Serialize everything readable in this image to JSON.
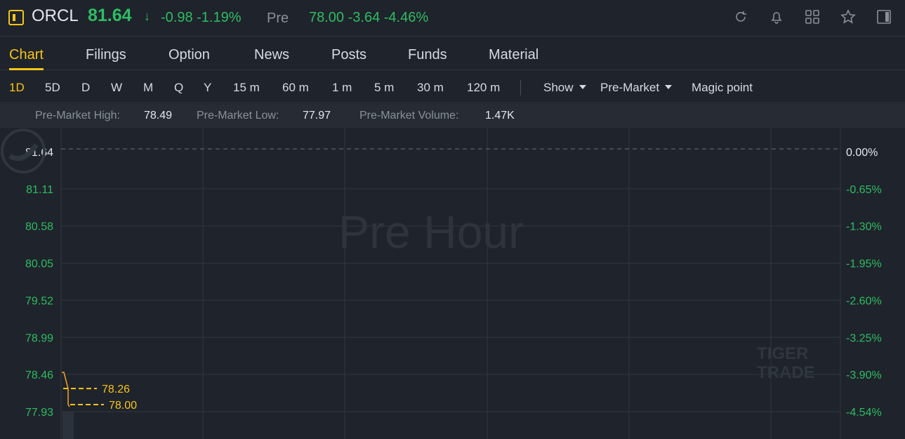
{
  "header": {
    "symbol": "ORCL",
    "price": "81.64",
    "change": "-0.98 -1.19%",
    "pre_label": "Pre",
    "pre_values": "78.00 -3.64 -4.46%",
    "price_color": "#2dbd63",
    "icons": [
      "refresh-icon",
      "bell-icon",
      "grid-icon",
      "star-icon",
      "panel-icon"
    ]
  },
  "tabs": [
    {
      "label": "Chart",
      "active": true
    },
    {
      "label": "Filings"
    },
    {
      "label": "Option"
    },
    {
      "label": "News"
    },
    {
      "label": "Posts"
    },
    {
      "label": "Funds"
    },
    {
      "label": "Material"
    }
  ],
  "periods": [
    "1D",
    "5D",
    "D",
    "W",
    "M",
    "Q",
    "Y",
    "15 m",
    "60 m",
    "1 m",
    "5 m",
    "30 m",
    "120 m"
  ],
  "active_period": "1D",
  "dropdowns": {
    "show": "Show",
    "session": "Pre-Market",
    "magic": "Magic point"
  },
  "stats": {
    "high_label": "Pre-Market High:",
    "high_value": "78.49",
    "low_label": "Pre-Market Low:",
    "low_value": "77.97",
    "volume_label": "Pre-Market Volume:",
    "volume_value": "1.47K"
  },
  "watermark": "Pre Hour",
  "logo": {
    "line1": "TIGER",
    "line2": "TRADE"
  },
  "chart_data": {
    "type": "line",
    "title": "",
    "xlabel": "",
    "ylabel": "",
    "y_ticks": [
      "81.64",
      "81.11",
      "80.58",
      "80.05",
      "79.52",
      "78.99",
      "78.46",
      "77.93"
    ],
    "pct_ticks": [
      "0.00%",
      "-0.65%",
      "-1.30%",
      "-1.95%",
      "-2.60%",
      "-3.25%",
      "-3.90%",
      "-4.54%"
    ],
    "ylim": [
      77.93,
      81.64
    ],
    "prev_close": 81.64,
    "series": [
      {
        "values": [
          78.49,
          78.26,
          78.0
        ]
      }
    ],
    "annotations": [
      "78.26",
      "78.00"
    ],
    "grid": true,
    "colors": {
      "line": "#f5a623",
      "label": "#f5c518",
      "tick": "#2dbd63"
    }
  }
}
